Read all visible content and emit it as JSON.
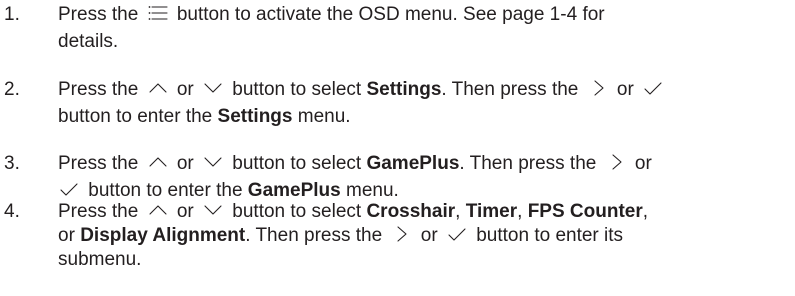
{
  "steps": [
    {
      "number": "1.",
      "line1": {
        "a": "Press the",
        "icon1": "menu-lines-icon",
        "b": "button to activate the OSD menu. See",
        "link": "page 1-4",
        "c": "for"
      },
      "line2": {
        "a": "details."
      }
    },
    {
      "number": "2.",
      "line1": {
        "a": "Press the",
        "icon1": "up-chevron-icon",
        "or1": "or",
        "icon2": "down-chevron-icon",
        "b": "button to select",
        "bold1": "Settings",
        "c": ". Then press the",
        "icon3": "right-chevron-icon",
        "or2": "or",
        "icon4": "checkmark-icon"
      },
      "line2": {
        "a": "button to enter the",
        "bold": "Settings",
        "b": "menu."
      }
    },
    {
      "number": "3.",
      "line1": {
        "a": "Press the",
        "icon1": "up-chevron-icon",
        "or1": "or",
        "icon2": "down-chevron-icon",
        "b": "button to select",
        "bold1": "GamePlus",
        "c": ". Then press the",
        "icon3": "right-chevron-icon",
        "or2": "or"
      },
      "line2": {
        "icon1": "checkmark-icon",
        "a": "button to enter the",
        "bold": "GamePlus",
        "b": "menu."
      }
    },
    {
      "number": "4.",
      "line1": {
        "a": "Press the",
        "icon1": "up-chevron-icon",
        "or1": "or",
        "icon2": "down-chevron-icon",
        "b": "button to select",
        "bold1": "Crosshair",
        "sep1": ",",
        "bold2": "Timer",
        "sep2": ",",
        "bold3": "FPS Counter",
        "sep3": ","
      },
      "line2": {
        "a": "or",
        "bold": "Display Alignment",
        "b": ". Then press the",
        "icon1": "right-chevron-icon",
        "or": "or",
        "icon2": "checkmark-icon",
        "c": "button to enter its"
      },
      "line3": {
        "a": "submenu."
      }
    }
  ]
}
